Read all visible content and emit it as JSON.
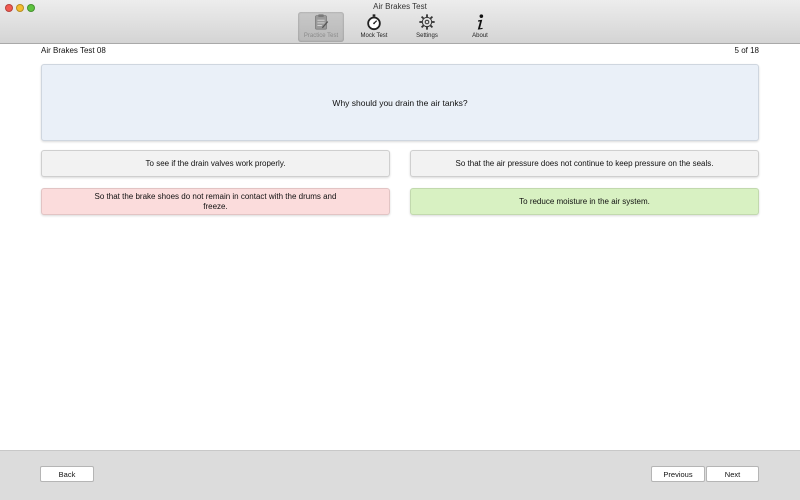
{
  "window": {
    "title": "Air Brakes Test"
  },
  "toolbar": {
    "items": [
      {
        "label": "Practice Test",
        "icon": "clipboard-icon",
        "active": true
      },
      {
        "label": "Mock Test",
        "icon": "stopwatch-icon",
        "active": false
      },
      {
        "label": "Settings",
        "icon": "gear-icon",
        "active": false
      },
      {
        "label": "About",
        "icon": "info-icon",
        "active": false
      }
    ]
  },
  "header": {
    "test_name": "Air Brakes Test 08",
    "progress": "5 of 18"
  },
  "question": {
    "text": "Why should you drain the air tanks?"
  },
  "answers": [
    {
      "text": "To see if the drain valves work properly.",
      "state": "neutral"
    },
    {
      "text": "So that the air pressure does not continue to keep pressure on the seals.",
      "state": "neutral"
    },
    {
      "text": "So that the brake shoes do not remain in contact with the drums and freeze.",
      "state": "wrong"
    },
    {
      "text": "To reduce moisture in the air system.",
      "state": "correct"
    }
  ],
  "footer": {
    "back_label": "Back",
    "previous_label": "Previous",
    "next_label": "Next"
  },
  "colors": {
    "question_bg": "#eaf0f8",
    "neutral_bg": "#f2f2f2",
    "wrong_bg": "#fbdcdc",
    "correct_bg": "#d8f1c2"
  }
}
